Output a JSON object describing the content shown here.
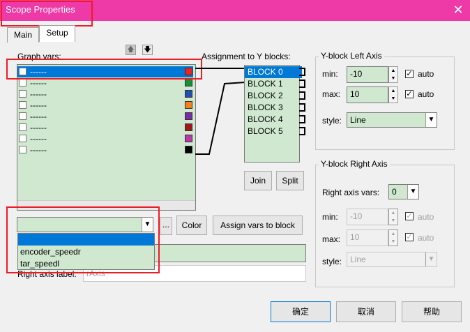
{
  "window": {
    "title": "Scope Properties",
    "close_glyph": "✕"
  },
  "tabs": [
    {
      "label": "Main"
    },
    {
      "label": "Setup"
    }
  ],
  "graph_vars": {
    "label": "Graph vars:",
    "up_glyph": "🡅",
    "down_glyph": "🡇",
    "rows": [
      {
        "name": "------",
        "color": "#ee2222"
      },
      {
        "name": "------",
        "color": "#1a8c3a"
      },
      {
        "name": "------",
        "color": "#1f4fb5"
      },
      {
        "name": "------",
        "color": "#f08020"
      },
      {
        "name": "------",
        "color": "#7a2aa8"
      },
      {
        "name": "------",
        "color": "#a01818"
      },
      {
        "name": "------",
        "color": "#b83aa8"
      },
      {
        "name": "------",
        "color": "#000000"
      }
    ]
  },
  "assignment": {
    "label": "Assignment to Y blocks:",
    "blocks": [
      "BLOCK 0",
      "BLOCK 1",
      "BLOCK 2",
      "BLOCK 3",
      "BLOCK 4",
      "BLOCK 5"
    ],
    "join_label": "Join",
    "split_label": "Split"
  },
  "var_select": {
    "value": "",
    "options": [
      "",
      "encoder_speedr",
      "tar_speedl"
    ],
    "ellipsis_label": "...",
    "color_label": "Color",
    "assign_label": "Assign vars to block"
  },
  "right_axis_label": {
    "label": "Right axis label:",
    "value": "rAxis"
  },
  "left_axis": {
    "title": "Y-block Left Axis",
    "min_label": "min:",
    "min_value": "-10",
    "max_label": "max:",
    "max_value": "10",
    "auto_label": "auto",
    "style_label": "style:",
    "style_value": "Line"
  },
  "right_axis": {
    "title": "Y-block Right Axis",
    "vars_label": "Right axis vars:",
    "vars_value": "0",
    "min_label": "min:",
    "min_value": "-10",
    "max_label": "max:",
    "max_value": "10",
    "auto_label": "auto",
    "style_label": "style:",
    "style_value": "Line"
  },
  "footer": {
    "ok_label": "确定",
    "cancel_label": "取消",
    "help_label": "帮助"
  },
  "colors": {
    "titlebar": "#ee3aa6",
    "list_bg": "#cfe8cf",
    "selection": "#0078d7",
    "highlight": "#ee1c24"
  }
}
